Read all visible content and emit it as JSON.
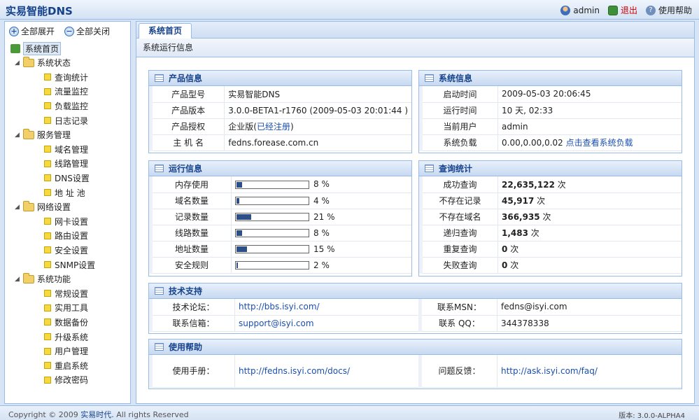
{
  "app": {
    "title": "实易智能DNS"
  },
  "topbar": {
    "user": "admin",
    "logout": "退出",
    "help": "使用帮助"
  },
  "sidebar": {
    "expand_all": "全部展开",
    "collapse_all": "全部关闭",
    "root": "系统首页",
    "groups": [
      {
        "label": "系统状态",
        "items": [
          "查询统计",
          "流量监控",
          "负载监控",
          "日志记录"
        ]
      },
      {
        "label": "服务管理",
        "items": [
          "域名管理",
          "线路管理",
          "DNS设置",
          "地 址 池"
        ]
      },
      {
        "label": "网络设置",
        "items": [
          "网卡设置",
          "路由设置",
          "安全设置",
          "SNMP设置"
        ]
      },
      {
        "label": "系统功能",
        "items": [
          "常规设置",
          "实用工具",
          "数据备份",
          "升级系统",
          "用户管理",
          "重启系统",
          "修改密码"
        ]
      }
    ]
  },
  "main": {
    "tab": "系统首页",
    "subtitle": "系统运行信息"
  },
  "product_info": {
    "title": "产品信息",
    "rows": [
      {
        "label": "产品型号",
        "value": "实易智能DNS"
      },
      {
        "label": "产品版本",
        "value": "3.0.0-BETA1-r1760 (2009-05-03 20:01:44 )"
      },
      {
        "label": "产品授权",
        "value": "企业版",
        "link": "已经注册"
      },
      {
        "label": "主 机 名",
        "value": "fedns.forease.com.cn"
      }
    ]
  },
  "system_info": {
    "title": "系统信息",
    "rows": [
      {
        "label": "启动时间",
        "value": "2009-05-03 20:06:45"
      },
      {
        "label": "运行时间",
        "value": "10 天, 02:33"
      },
      {
        "label": "当前用户",
        "value": "admin"
      },
      {
        "label": "系统负载",
        "value": "0.00,0.00,0.02",
        "link": "点击查看系统负载"
      }
    ]
  },
  "run_info": {
    "title": "运行信息",
    "rows": [
      {
        "label": "内存使用",
        "percent": 8,
        "text": "8 %"
      },
      {
        "label": "域名数量",
        "percent": 4,
        "text": "4 %"
      },
      {
        "label": "记录数量",
        "percent": 21,
        "text": "21 %"
      },
      {
        "label": "线路数量",
        "percent": 8,
        "text": "8 %"
      },
      {
        "label": "地址数量",
        "percent": 15,
        "text": "15 %"
      },
      {
        "label": "安全规则",
        "percent": 2,
        "text": "2 %"
      }
    ]
  },
  "query_stats": {
    "title": "查询统计",
    "unit": "次",
    "rows": [
      {
        "label": "成功查询",
        "value": "22,635,122"
      },
      {
        "label": "不存在记录",
        "value": "45,917"
      },
      {
        "label": "不存在域名",
        "value": "366,935"
      },
      {
        "label": "递归查询",
        "value": "1,483"
      },
      {
        "label": "重复查询",
        "value": "0"
      },
      {
        "label": "失败查询",
        "value": "0"
      }
    ]
  },
  "tech_support": {
    "title": "技术支持",
    "rows": [
      {
        "label": "技术论坛：",
        "value": "http://bbs.isyi.com/",
        "label2": "联系MSN：",
        "value2": "fedns@isyi.com"
      },
      {
        "label": "联系信箱：",
        "value": "support@isyi.com",
        "label2": "联系 QQ：",
        "value2": "344378338"
      }
    ]
  },
  "help_panel": {
    "title": "使用帮助",
    "label": "使用手册：",
    "value": "http://fedns.isyi.com/docs/",
    "label2": "问题反馈：",
    "value2": "http://ask.isyi.com/faq/"
  },
  "footer": {
    "copyright_prefix": "Copyright © 2009",
    "company": "实易时代.",
    "copyright_suffix": "All rights Reserved",
    "version": "版本: 3.0.0-ALPHA4"
  },
  "icons": {
    "user": "user-icon",
    "logout": "logout-icon",
    "help": "help-icon",
    "home": "home-icon",
    "folder": "folder-icon",
    "leaf": "leaf-icon",
    "grid": "grid-icon"
  },
  "colors": {
    "accent": "#15428b",
    "border": "#99bbe8",
    "bar": "#2b4f86",
    "link": "#1a4fb0",
    "logout": "#cc0000"
  }
}
